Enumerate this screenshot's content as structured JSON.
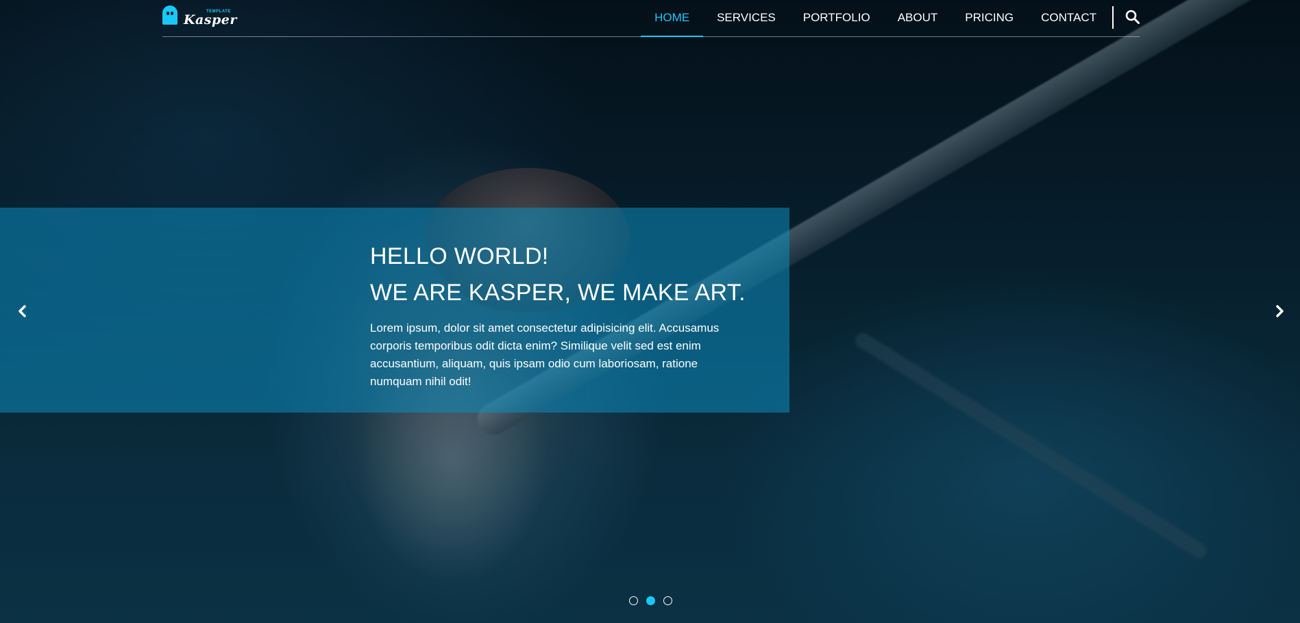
{
  "header": {
    "logo": {
      "small_text": "TEMPLATE",
      "brand": "Kasper"
    },
    "nav": [
      {
        "label": "HOME",
        "active": true
      },
      {
        "label": "SERVICES",
        "active": false
      },
      {
        "label": "PORTFOLIO",
        "active": false
      },
      {
        "label": "ABOUT",
        "active": false
      },
      {
        "label": "PRICING",
        "active": false
      },
      {
        "label": "CONTACT",
        "active": false
      }
    ],
    "search_icon": "search-icon"
  },
  "slider": {
    "heading_line1": "HELLO WORLD!",
    "heading_line2": "WE ARE KASPER, WE MAKE ART.",
    "text": "Lorem ipsum, dolor sit amet consectetur adipisicing elit. Accusamus corporis temporibus odit dicta enim? Similique velit sed est enim accusantium, aliquam, quis ipsam odio cum laboriosam, ratione numquam nihil odit!",
    "prev_icon": "chevron-left-icon",
    "next_icon": "chevron-right-icon",
    "dots": {
      "count": 3,
      "active_index": 1
    }
  },
  "colors": {
    "accent": "#19c8fa",
    "caption_overlay": "#0c8cbe"
  }
}
